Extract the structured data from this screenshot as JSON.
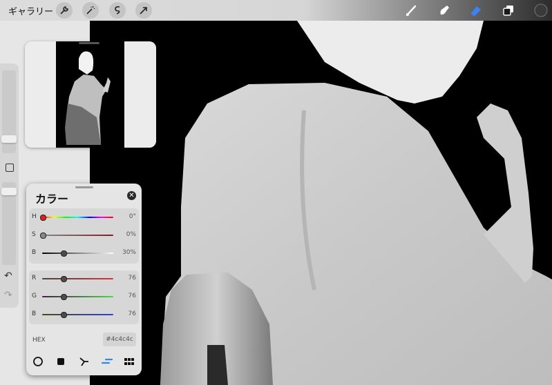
{
  "toolbar": {
    "gallery_label": "ギャラリー",
    "left_tools": [
      "wrench-icon",
      "magic-wand-icon",
      "selection-icon",
      "transform-arrow-icon"
    ],
    "right_tools": [
      "brush-icon",
      "smudge-icon",
      "eraser-icon",
      "layers-icon",
      "color-swatch-icon"
    ],
    "active_tool": "eraser-icon",
    "active_color": "#3a3a3a",
    "eraser_color": "#3b82f6"
  },
  "sidebar": {
    "size_slider_level": 0.66,
    "opacity_slider_level": 0.94,
    "undo_label": "↶",
    "redo_label": "↷"
  },
  "color_panel": {
    "title": "カラー",
    "close_label": "✕",
    "hsb": [
      {
        "label": "H",
        "value": "0°",
        "fraction": 0.0
      },
      {
        "label": "S",
        "value": "0%",
        "fraction": 0.0
      },
      {
        "label": "B",
        "value": "30%",
        "fraction": 0.3
      }
    ],
    "rgb": [
      {
        "label": "R",
        "value": "76",
        "fraction": 0.298
      },
      {
        "label": "G",
        "value": "76",
        "fraction": 0.298
      },
      {
        "label": "B",
        "value": "76",
        "fraction": 0.298
      }
    ],
    "hex_label": "HEX",
    "hex_value": "#4c4c4c",
    "current_color": "#4c4c4c",
    "modes": [
      "disc-mode-icon",
      "classic-mode-icon",
      "harmony-mode-icon",
      "value-mode-icon",
      "palette-mode-icon"
    ],
    "active_mode": "value-mode-icon",
    "accent": "#2d88f0"
  }
}
